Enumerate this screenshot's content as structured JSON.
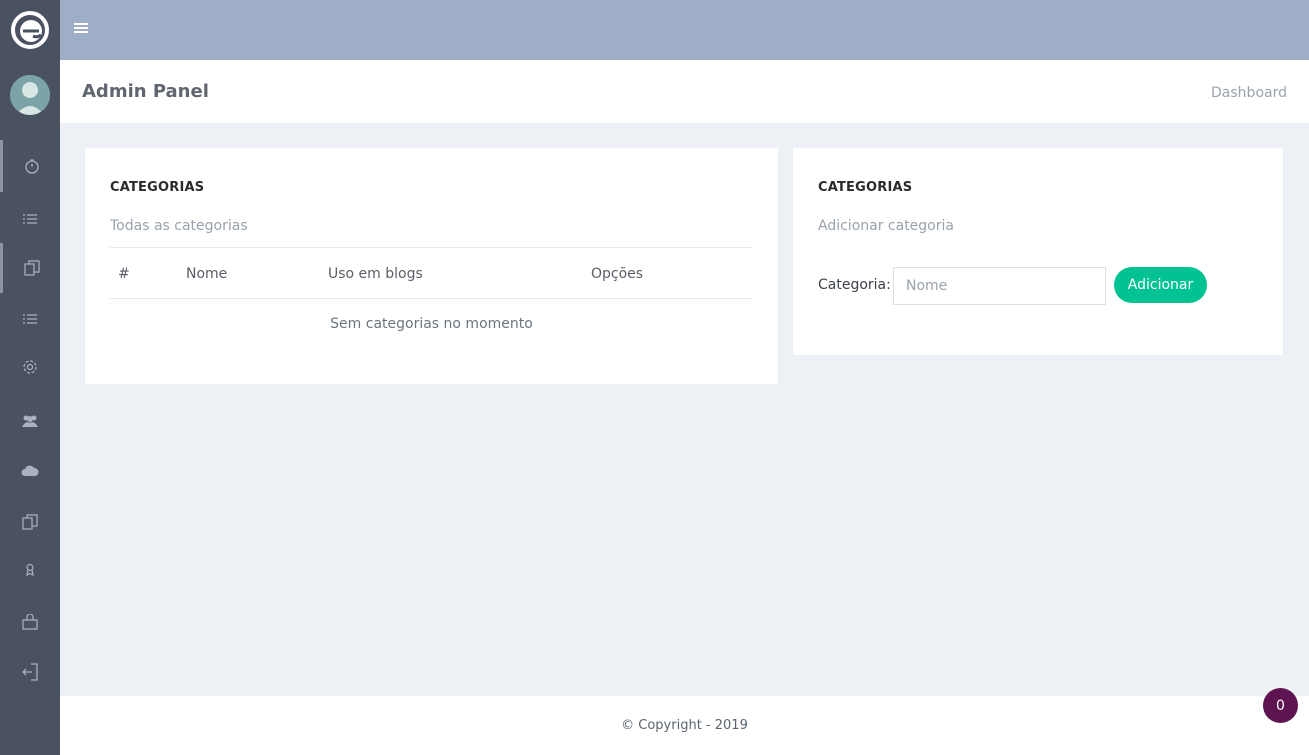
{
  "header": {
    "page_title": "Admin Panel",
    "breadcrumb": "Dashboard"
  },
  "sidebar": {
    "icons": [
      "clock-icon",
      "list-icon",
      "copy-icon",
      "list-icon",
      "gear-icon",
      "users-icon",
      "cloud-icon",
      "copy-icon",
      "badge-icon",
      "bag-icon",
      "logout-icon"
    ]
  },
  "categories_list": {
    "title": "CATEGORIAS",
    "subtitle": "Todas as categorias",
    "columns": [
      "#",
      "Nome",
      "Uso em blogs",
      "Opções"
    ],
    "empty_message": "Sem categorias no momento"
  },
  "add_category": {
    "title": "CATEGORIAS",
    "subtitle": "Adicionar categoria",
    "field_label": "Categoria:",
    "input_placeholder": "Nome",
    "input_value": "",
    "button_label": "Adicionar"
  },
  "footer": {
    "copyright": "© Copyright - 2019"
  },
  "badge": {
    "count": "0"
  },
  "colors": {
    "sidebar_bg": "#4a5261",
    "topbar_bg": "#9eaec6",
    "content_bg": "#edf1f5",
    "accent_button": "#00c292",
    "badge_bg": "#5d1451"
  }
}
